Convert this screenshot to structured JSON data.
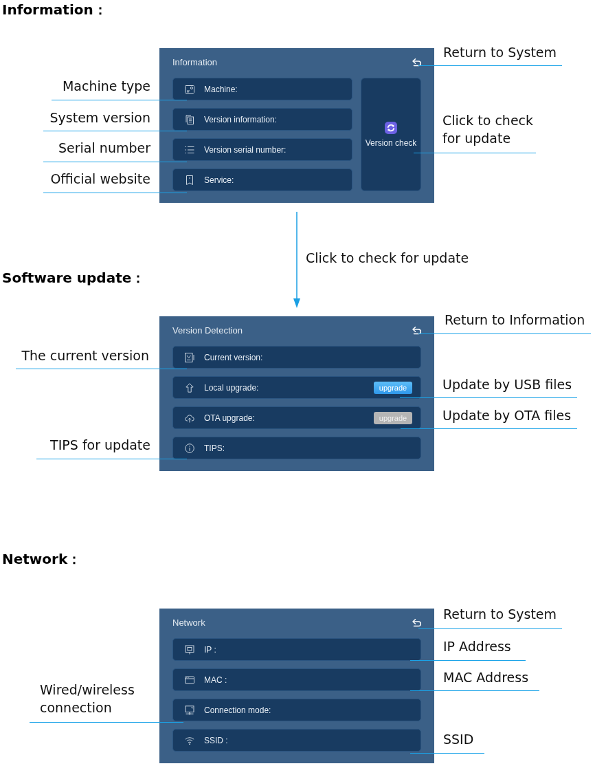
{
  "sections": [
    {
      "heading": "Information：",
      "panel": {
        "title": "Information",
        "rows": [
          {
            "label": "Machine:"
          },
          {
            "label": "Version information:"
          },
          {
            "label": "Version serial number:"
          },
          {
            "label": "Service:"
          }
        ],
        "side_button": {
          "label": "Version check"
        }
      },
      "callouts": [
        "Return to System",
        "Machine type",
        "System version",
        "Click to check for update",
        "Serial number",
        "Official website"
      ]
    },
    {
      "heading": "Software update：",
      "panel": {
        "title": "Version Detection",
        "rows": [
          {
            "label": "Current version:"
          },
          {
            "label": "Local upgrade:",
            "button": {
              "label": "upgrade",
              "disabled": false
            }
          },
          {
            "label": "OTA upgrade:",
            "button": {
              "label": "upgrade",
              "disabled": true
            }
          },
          {
            "label": "TIPS:"
          }
        ]
      },
      "callouts": [
        "Return to Information",
        "The current version",
        "Update by USB files",
        "Update by OTA files",
        "TIPS for update"
      ]
    },
    {
      "heading": "Network：",
      "panel": {
        "title": "Network",
        "rows": [
          {
            "label": "IP :"
          },
          {
            "label": "MAC :"
          },
          {
            "label": "Connection mode:"
          },
          {
            "label": "SSID :"
          }
        ]
      },
      "callouts": [
        "Return to System",
        "IP Address",
        "MAC Address",
        "Wired/wireless connection",
        "SSID"
      ]
    }
  ],
  "transition": {
    "label": "Click to check for update"
  }
}
